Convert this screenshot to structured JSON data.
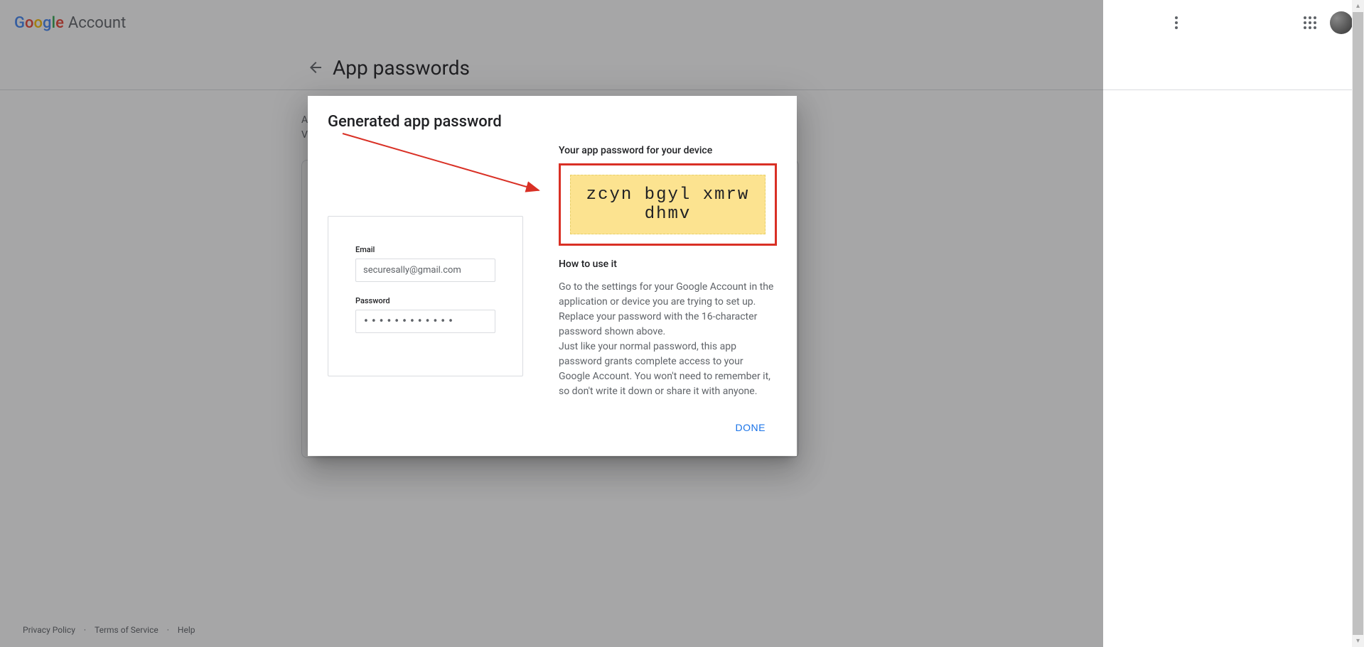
{
  "header": {
    "logo_account": "Account"
  },
  "page": {
    "title": "App passwords",
    "description_line1": "A",
    "description_line2": "V"
  },
  "modal": {
    "title": "Generated app password",
    "device_label": "Your app password for your device",
    "password": "zcyn bgyl xmrw dhmv",
    "how_to_label": "How to use it",
    "how_to_text_1": "Go to the settings for your Google Account in the application or device you are trying to set up. Replace your password with the 16-character password shown above.",
    "how_to_text_2": "Just like your normal password, this app password grants complete access to your Google Account. You won't need to remember it, so don't write it down or share it with anyone.",
    "done_label": "DONE",
    "sample": {
      "email_label": "Email",
      "email_value": "securesally@gmail.com",
      "password_label": "Password",
      "password_value": "••••••••••••"
    }
  },
  "footer": {
    "privacy": "Privacy Policy",
    "terms": "Terms of Service",
    "help": "Help"
  }
}
